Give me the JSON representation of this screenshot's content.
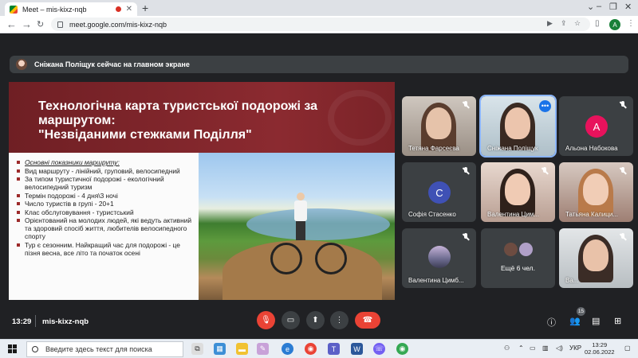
{
  "browser": {
    "tab_title": "Meet – mis-kixz-nqb",
    "url": "meet.google.com/mis-kixz-nqb",
    "profile_initial": "A"
  },
  "meet": {
    "banner": "Сніжана Поліщук сейчас на главном экране",
    "slide": {
      "title_line1": "Технологічна карта туристської подорожі за маршрутом:",
      "title_line2": "\"Незвіданими стежками Поділля\"",
      "items": [
        "Основні показники маршруту:",
        "Вид маршруту - лінійний, груповий, велосипедний",
        "За типом туристичної подорожі - екологічний велосипедний туризм",
        "Термін подорожі - 4 дня\\3 ночі",
        "Число туристів в групі - 20+1",
        "Клас обслуговування - туристський",
        "Орієнтований на молодих людей, які ведуть активний та здоровий спосіб життя, любителів велосипедного спорту",
        "Тур є сезонним. Найкращий час для подорожі - це пізня весна, все літо та початок осені"
      ]
    },
    "participants": [
      {
        "name": "Тетяна Фарсеєва"
      },
      {
        "name": "Сніжана Поліщук"
      },
      {
        "name": "Альона Набокова",
        "initial": "А",
        "color": "#e8125c"
      },
      {
        "name": "Софія Стасенко",
        "initial": "С",
        "color": "#3f51b5"
      },
      {
        "name": "Валентина Цим..."
      },
      {
        "name": "Татьяна Калици..."
      },
      {
        "name": "Валентина Цимб..."
      },
      {
        "name": "Ещё 6 чел."
      },
      {
        "name": "Ва..."
      }
    ],
    "controls": {
      "time": "13:29",
      "meeting_code": "mis-kixz-nqb",
      "participants_count": "15"
    }
  },
  "taskbar": {
    "search_placeholder": "Введите здесь текст для поиска",
    "language": "УКР",
    "time": "13:29",
    "date": "02.06.2022"
  }
}
